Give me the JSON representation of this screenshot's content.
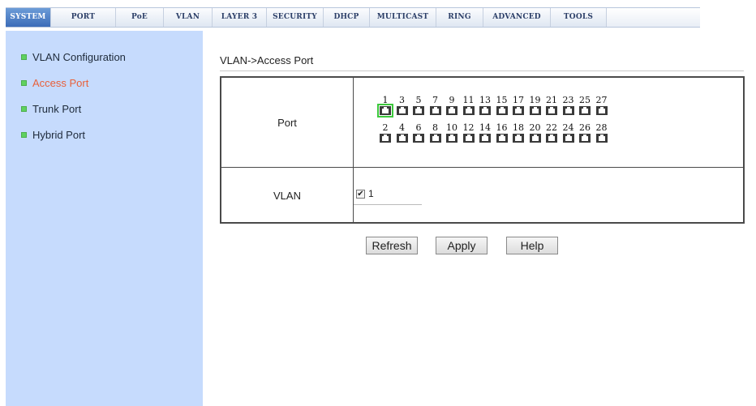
{
  "tabs": [
    "SYSTEM",
    "PORT",
    "PoE",
    "VLAN",
    "LAYER 3",
    "SECURITY",
    "DHCP",
    "MULTICAST",
    "RING",
    "ADVANCED",
    "TOOLS"
  ],
  "sidebar": {
    "items": [
      {
        "label": "VLAN Configuration"
      },
      {
        "label": "Access Port"
      },
      {
        "label": "Trunk Port"
      },
      {
        "label": "Hybrid Port"
      }
    ]
  },
  "breadcrumb": "VLAN->Access Port",
  "table": {
    "port_label": "Port",
    "vlan_label": "VLAN",
    "ports_top": [
      "1",
      "3",
      "5",
      "7",
      "9",
      "11",
      "13",
      "15",
      "17",
      "19",
      "21",
      "23",
      "25",
      "27"
    ],
    "ports_bottom": [
      "2",
      "4",
      "6",
      "8",
      "10",
      "12",
      "14",
      "16",
      "18",
      "20",
      "22",
      "24",
      "26",
      "28"
    ],
    "selected_port": "1",
    "vlan_option": {
      "label": "1",
      "checked": true
    }
  },
  "buttons": {
    "refresh": "Refresh",
    "apply": "Apply",
    "help": "Help"
  },
  "colors": {
    "sidebar_bg": "#c6dbfd",
    "active_item": "#e8603a",
    "active_tab": "#3c6cb8",
    "bullet": "#5fd15f",
    "port_selected": "#3cc83c"
  }
}
